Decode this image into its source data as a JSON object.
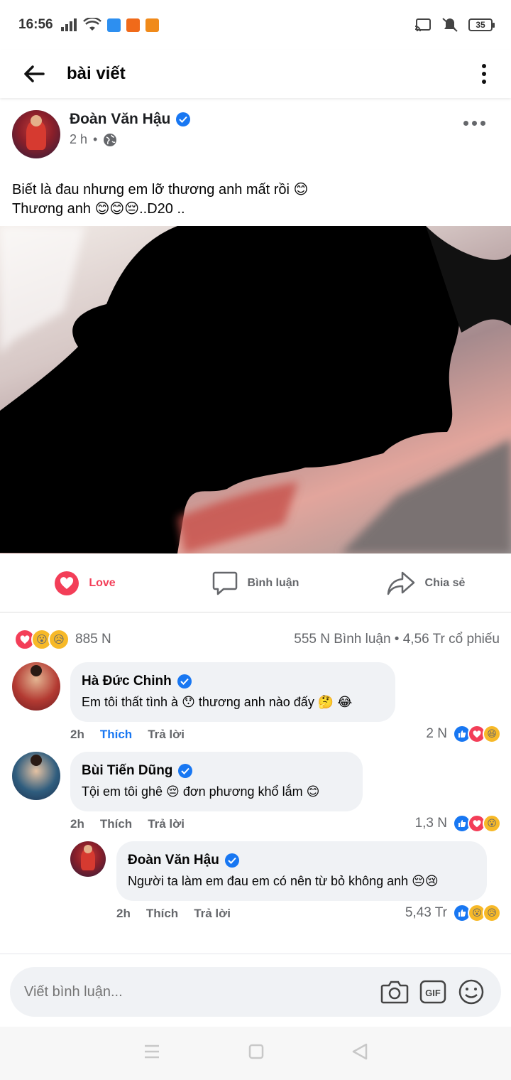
{
  "status": {
    "time": "16:56",
    "battery": "35"
  },
  "header": {
    "title": "bài viết"
  },
  "post": {
    "author": "Đoàn Văn Hậu",
    "time": "2 h",
    "separator": "•",
    "text_line1": "Biết là đau nhưng em lỡ thương anh mất rồi 😊",
    "text_line2": "Thương anh 😊😊😔..D20 .."
  },
  "actions": {
    "love": "Love",
    "comment": "Bình luận",
    "share": "Chia sẻ"
  },
  "summary": {
    "reaction_count": "885 N",
    "stats": "555 N  Bình luận • 4,56 Tr  cổ phiếu"
  },
  "comments": [
    {
      "name": "Hà Đức Chinh",
      "text": "Em tôi thất tình à 😯 thương anh nào đấy 🤔 😂",
      "time": "2h",
      "like": "Thích",
      "reply": "Trả lời",
      "count": "2 N",
      "reaction_emoji": "😆"
    },
    {
      "name": "Bùi Tiến Dũng",
      "text": "Tội em tôi ghê 😔  đơn phương khổ lắm 😊",
      "time": "2h",
      "like": "Thích",
      "reply": "Trả lời",
      "count": "1,3 N",
      "reaction_emoji": "😮"
    },
    {
      "name": "Đoàn Văn Hậu",
      "text": "Người ta làm em đau em có nên từ bỏ không anh 😔😢",
      "time": "2h",
      "like": "Thích",
      "reply": "Trả lời",
      "count": "5,43 Tr",
      "reaction_emoji_1": "😮",
      "reaction_emoji_2": "😥"
    }
  ],
  "summary_emojis": {
    "wow": "😮",
    "sad": "😥"
  },
  "compose": {
    "placeholder": "Viết bình luận...",
    "gif": "GIF"
  },
  "colors": {
    "brand_blue": "#1877f2",
    "love_red": "#f33e58",
    "bubble_bg": "#f0f2f5"
  }
}
